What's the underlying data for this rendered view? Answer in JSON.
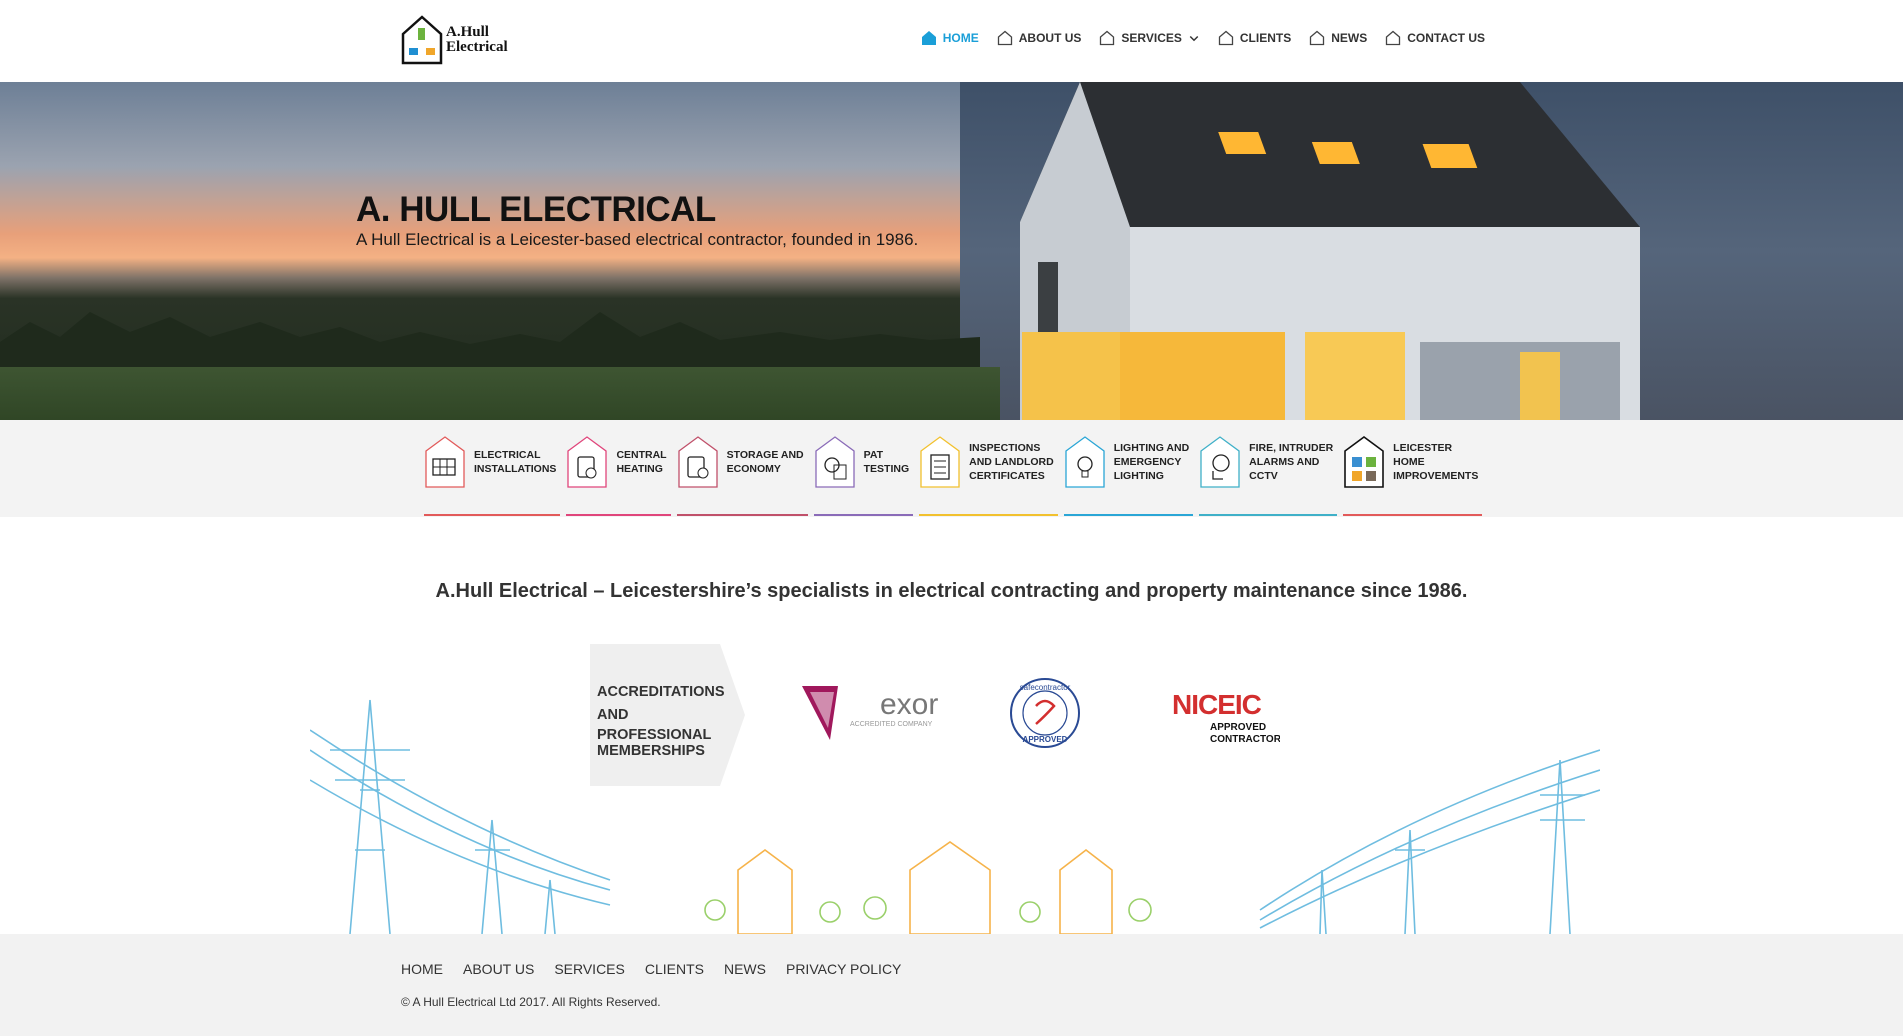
{
  "logo": {
    "line1": "A.Hull",
    "line2": "Electrical"
  },
  "nav": [
    {
      "label": "HOME",
      "active": true
    },
    {
      "label": "ABOUT US",
      "active": false
    },
    {
      "label": "SERVICES",
      "active": false,
      "dropdown": true
    },
    {
      "label": "CLIENTS",
      "active": false
    },
    {
      "label": "NEWS",
      "active": false
    },
    {
      "label": "CONTACT US",
      "active": false
    }
  ],
  "hero": {
    "title": "A. HULL ELECTRICAL",
    "subtitle": "A Hull Electrical is a Leicester-based electrical contractor, founded in 1986."
  },
  "services": [
    {
      "lines": [
        "ELECTRICAL",
        "INSTALLATIONS"
      ],
      "color": "#e25a5a",
      "icon": "solar-panel-icon"
    },
    {
      "lines": [
        "CENTRAL",
        "HEATING"
      ],
      "color": "#e0457b",
      "icon": "boiler-icon"
    },
    {
      "lines": [
        "STORAGE AND",
        "ECONOMY"
      ],
      "color": "#c0506a",
      "icon": "battery-icon"
    },
    {
      "lines": [
        "PAT",
        "TESTING"
      ],
      "color": "#8a6bb8",
      "icon": "test-meter-icon"
    },
    {
      "lines": [
        "INSPECTIONS",
        "AND LANDLORD",
        "CERTIFICATES"
      ],
      "color": "#f2c12e",
      "icon": "checklist-icon"
    },
    {
      "lines": [
        "LIGHTING AND",
        "EMERGENCY",
        "LIGHTING"
      ],
      "color": "#2aa6d6",
      "icon": "lightbulb-icon"
    },
    {
      "lines": [
        "FIRE, INTRUDER",
        "ALARMS AND",
        "CCTV"
      ],
      "color": "#3fb0c8",
      "icon": "cctv-icon"
    },
    {
      "lines": [
        "LEICESTER",
        "HOME",
        "IMPROVEMENTS"
      ],
      "color": "#e25a5a",
      "icon": "home-improvements-icon"
    }
  ],
  "tagline": "A.Hull Electrical – Leicestershire’s specialists in electrical contracting and property maintenance since 1986.",
  "accreditations": {
    "heading": [
      "ACCREDITATIONS",
      "AND",
      "PROFESSIONAL",
      "MEMBERSHIPS"
    ],
    "exor": {
      "name": "exor",
      "sub": "ACCREDITED COMPANY"
    },
    "safecontractor": {
      "top": "safecontractor",
      "bottom": "APPROVED"
    },
    "niceic": {
      "name": "NICEIC",
      "line1": "APPROVED",
      "line2": "CONTRACTOR"
    }
  },
  "footer": {
    "links": [
      "HOME",
      "ABOUT US",
      "SERVICES",
      "CLIENTS",
      "NEWS",
      "PRIVACY POLICY"
    ],
    "copyright": "© A Hull Electrical Ltd 2017. All Rights Reserved."
  }
}
